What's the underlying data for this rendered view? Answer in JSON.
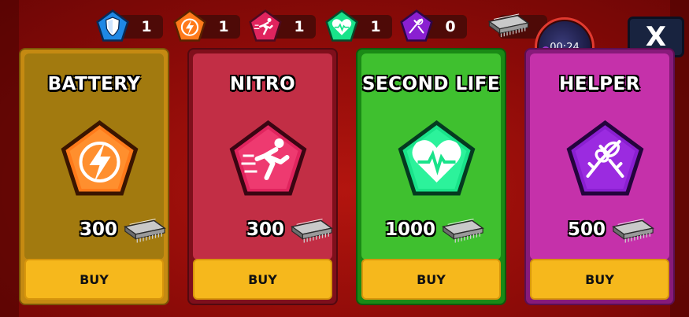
{
  "inventory": [
    {
      "icon": "shield-icon",
      "count": "1",
      "color": "#1e88e5"
    },
    {
      "icon": "lightning-icon",
      "count": "1",
      "color": "#ff7a1a"
    },
    {
      "icon": "runner-icon",
      "count": "1",
      "color": "#e0245e"
    },
    {
      "icon": "heart-icon",
      "count": "1",
      "color": "#19e38a"
    },
    {
      "icon": "handshake-icon",
      "count": "0",
      "color": "#8a1fd1"
    }
  ],
  "currency_icon": "chip-icon",
  "timer": "00:24",
  "close_label": "X",
  "items": [
    {
      "title": "BATTERY",
      "price": "300",
      "buy_label": "BUY",
      "icon": "lightning-icon",
      "color": "#ff7a1a"
    },
    {
      "title": "NITRO",
      "price": "300",
      "buy_label": "BUY",
      "icon": "runner-icon",
      "color": "#e0245e"
    },
    {
      "title": "SECOND LIFE",
      "price": "1000",
      "buy_label": "BUY",
      "icon": "heart-icon",
      "color": "#19e38a"
    },
    {
      "title": "HELPER",
      "price": "500",
      "buy_label": "BUY",
      "icon": "handshake-icon",
      "color": "#8a1fd1"
    }
  ]
}
